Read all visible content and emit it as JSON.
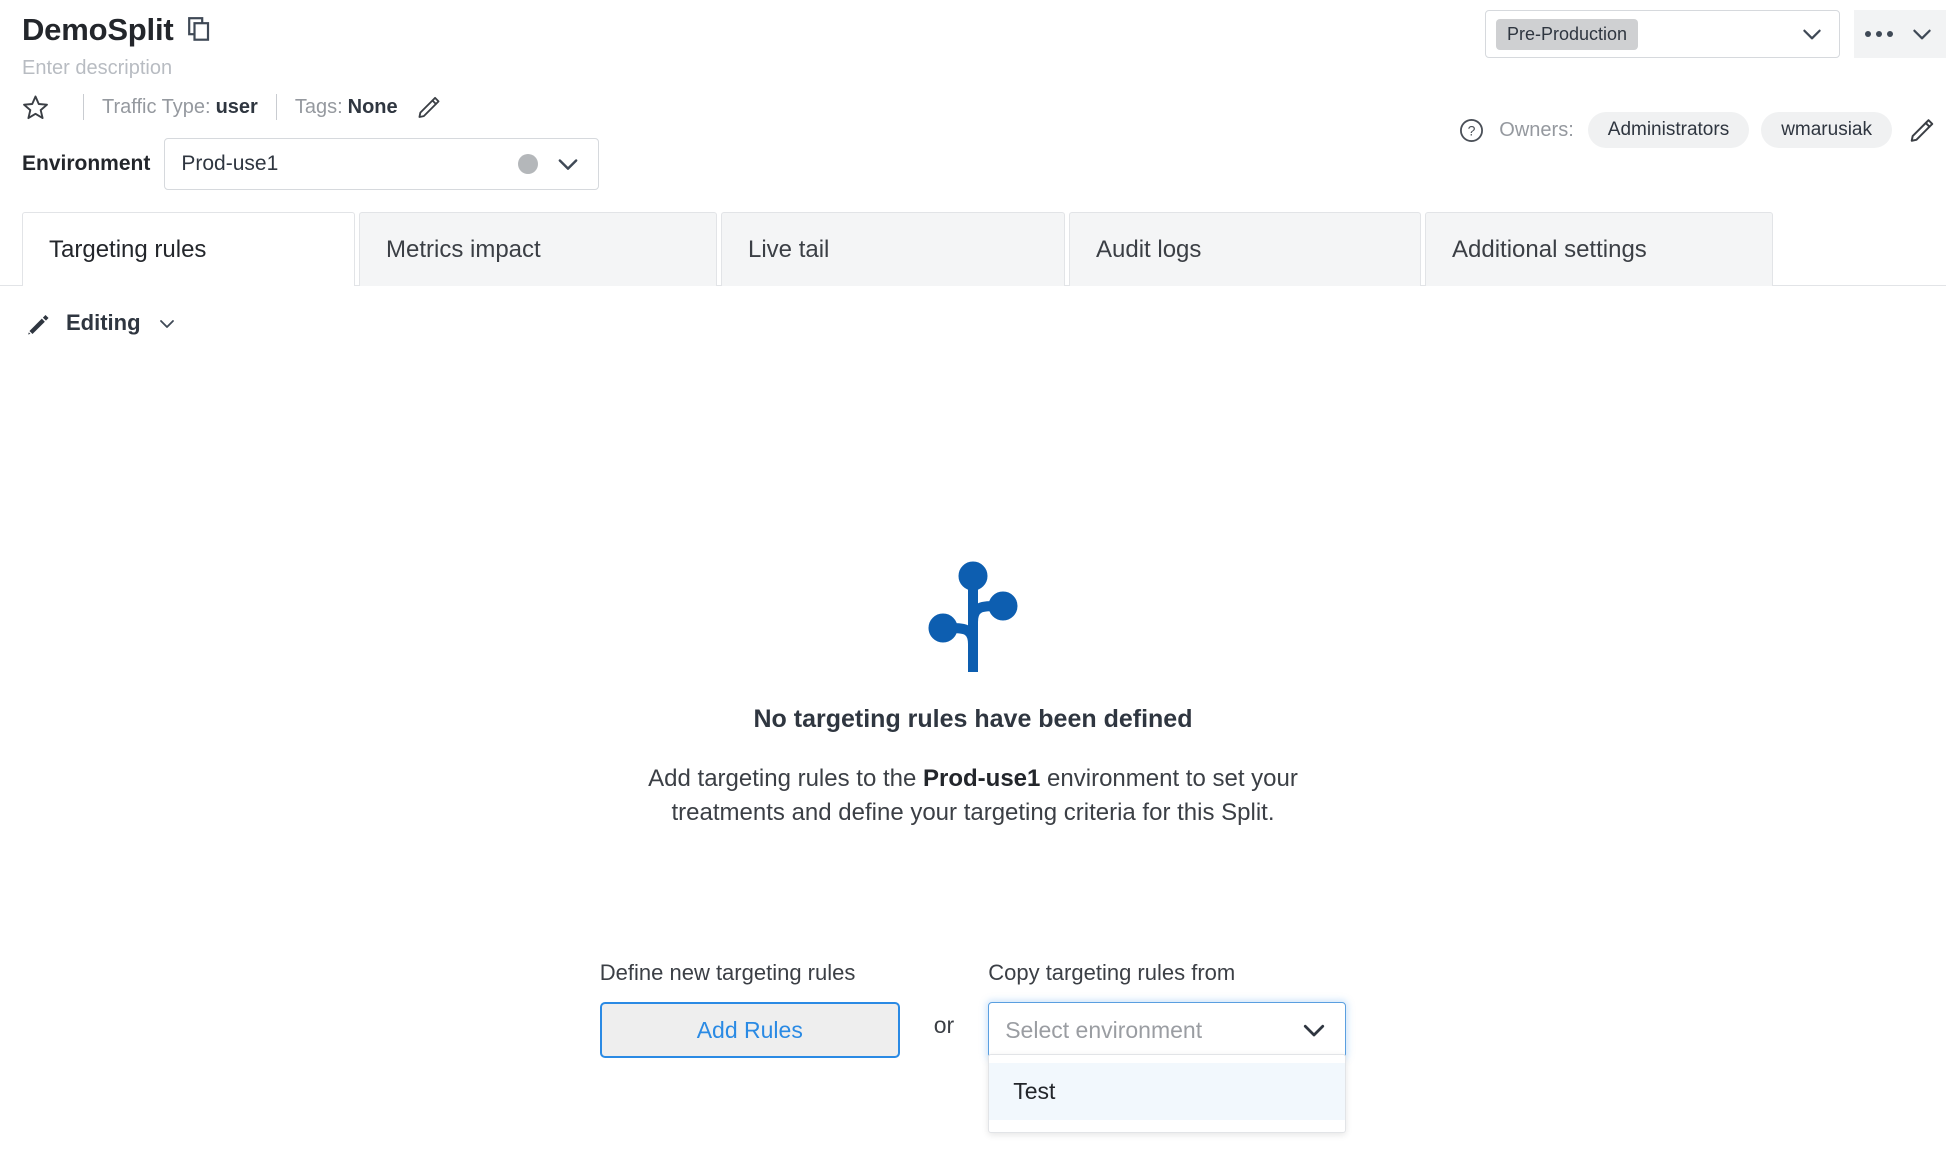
{
  "header": {
    "title": "DemoSplit",
    "copy_icon": "copy-icon",
    "description_placeholder": "Enter description",
    "star_icon": "star-icon",
    "traffic_type_label": "Traffic Type:",
    "traffic_type_value": "user",
    "tags_label": "Tags:",
    "tags_value": "None",
    "edit_pencil_icon": "pencil-icon",
    "scope_pill": "Pre-Production",
    "kebab_label": "more-actions",
    "help_icon": "question-circle-icon",
    "owners_label": "Owners:",
    "owners": [
      "Administrators",
      "wmarusiak"
    ],
    "owners_edit_icon": "pencil-icon"
  },
  "environment": {
    "label": "Environment",
    "selected": "Prod-use1",
    "status_dot_color": "#b4b7ba"
  },
  "tabs": [
    {
      "label": "Targeting rules",
      "active": true
    },
    {
      "label": "Metrics impact",
      "active": false
    },
    {
      "label": "Live tail",
      "active": false
    },
    {
      "label": "Audit logs",
      "active": false
    },
    {
      "label": "Additional settings",
      "active": false
    }
  ],
  "editing_bar": {
    "icon": "pencil-filled-icon",
    "label": "Editing",
    "chevron": "chevron-down-icon"
  },
  "empty_state": {
    "illustration": "branch-split-icon",
    "illustration_color": "#0d5eb0",
    "title": "No targeting rules have been defined",
    "desc_part1": "Add targeting rules to the ",
    "desc_env": "Prod-use1",
    "desc_part2": " environment to set your treatments and define your targeting criteria for this Split."
  },
  "actions": {
    "define_caption": "Define new targeting rules",
    "add_rules_label": "Add Rules",
    "or_label": "or",
    "copy_caption": "Copy targeting rules from",
    "copy_select_placeholder": "Select environment",
    "copy_options": [
      "Test"
    ],
    "accent_color": "#2a8ae4"
  }
}
